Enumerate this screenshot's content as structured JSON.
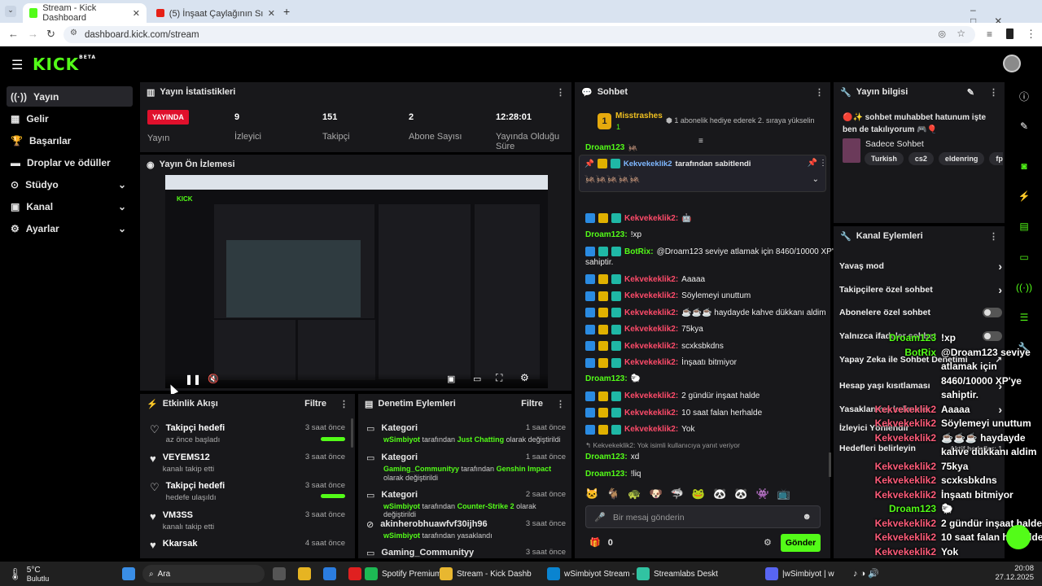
{
  "browser": {
    "tabs": [
      {
        "title": "Stream - Kick Dashboard",
        "active": true
      },
      {
        "title": "(5) İnşaat Çaylağının Sınavı! 😱",
        "active": false
      }
    ],
    "url": "dashboard.kick.com/stream"
  },
  "sidebar": {
    "items": [
      {
        "label": "Yayın",
        "active": true
      },
      {
        "label": "Gelir"
      },
      {
        "label": "Başarılar"
      },
      {
        "label": "Droplar ve ödüller"
      },
      {
        "label": "Stüdyo"
      },
      {
        "label": "Kanal"
      },
      {
        "label": "Ayarlar"
      }
    ]
  },
  "stats": {
    "title": "Yayın İstatistikleri",
    "live_badge": "YAYINDA",
    "live_label": "Yayın",
    "viewers": "9",
    "viewers_label": "İzleyici",
    "followers": "151",
    "followers_label": "Takipçi",
    "subs": "2",
    "subs_label": "Abone Sayısı",
    "uptime": "12:28:01",
    "uptime_label": "Yayında Olduğu Süre"
  },
  "preview": {
    "title": "Yayın Ön İzlemesi"
  },
  "activity": {
    "title": "Etkinlik Akışı",
    "filter": "Filtre",
    "items": [
      {
        "title": "Takipçi hedefi",
        "sub": "az önce başladı",
        "time": "3 saat önce",
        "progress": 1
      },
      {
        "title": "VEYEMS12",
        "sub": "kanalı takip etti",
        "time": "3 saat önce"
      },
      {
        "title": "Takipçi hedefi",
        "sub": "hedefe ulaşıldı",
        "time": "3 saat önce",
        "progress": 1
      },
      {
        "title": "VM3SS",
        "sub": "kanalı takip etti",
        "time": "3 saat önce"
      },
      {
        "title": "Kkarsak",
        "sub": "",
        "time": "4 saat önce"
      }
    ]
  },
  "moderation": {
    "title": "Denetim Eylemleri",
    "filter": "Filtre",
    "items": [
      {
        "title": "Kategori",
        "time": "1 saat önce",
        "actor": "wSimbiyot",
        "mid": "tarafından",
        "value": "Just Chatting",
        "end": "olarak değiştirildi"
      },
      {
        "title": "Kategori",
        "time": "1 saat önce",
        "actor": "Gaming_Communityy",
        "mid": "tarafından",
        "value": "Genshin Impact",
        "end": "olarak değiştirildi"
      },
      {
        "title": "Kategori",
        "time": "2 saat önce",
        "actor": "wSimbiyot",
        "mid": "tarafından",
        "value": "Counter-Strike 2",
        "end": "olarak değiştirildi"
      },
      {
        "title": "akinherobhuawfvf30ijh96",
        "time": "3 saat önce",
        "actor": "wSimbiyot",
        "mid": "tarafından yasaklandı",
        "value": "",
        "end": ""
      },
      {
        "title": "Gaming_Communityy",
        "time": "3 saat önce",
        "actor": "",
        "mid": "",
        "value": "",
        "end": ""
      }
    ]
  },
  "chat": {
    "title": "Sohbet",
    "gifter": "Misstrashes",
    "gifter_rank": "1",
    "gift_note": "1 abonelik hediye ederek 2. sıraya yükselin",
    "pinned_user": "Kekvekeklik2",
    "pinned_text": "tarafından sabitlendi",
    "messages": [
      {
        "user": "Droam123",
        "kind": "green",
        "text": "🦗"
      },
      {
        "user": "Kekvekeklik2:",
        "kind": "red",
        "text": "🤖"
      },
      {
        "user": "Droam123:",
        "kind": "green",
        "text": "!xp"
      },
      {
        "user": "BotRix:",
        "kind": "bot",
        "text": "@Droam123 seviye atlamak için 8460/10000 XP'ye"
      },
      {
        "user": "",
        "kind": "cont",
        "text": "sahiptir."
      },
      {
        "user": "Kekvekeklik2:",
        "kind": "red",
        "text": "Aaaaa"
      },
      {
        "user": "Kekvekeklik2:",
        "kind": "red",
        "text": "Söylemeyi unuttum"
      },
      {
        "user": "Kekvekeklik2:",
        "kind": "red",
        "text": "☕☕☕ haydayde kahve dükkanı aldim"
      },
      {
        "user": "Kekvekeklik2:",
        "kind": "red",
        "text": "75kya"
      },
      {
        "user": "Kekvekeklik2:",
        "kind": "red",
        "text": "scxksbkdns"
      },
      {
        "user": "Kekvekeklik2:",
        "kind": "red",
        "text": "İnşaatı bitmiyor"
      },
      {
        "user": "Droam123:",
        "kind": "green",
        "text": "🐑"
      },
      {
        "user": "Kekvekeklik2:",
        "kind": "red",
        "text": "2 gündür inşaat halde"
      },
      {
        "user": "Kekvekeklik2:",
        "kind": "red",
        "text": "10 saat falan herhalde"
      },
      {
        "user": "Kekvekeklik2:",
        "kind": "red",
        "text": "Yok"
      },
      {
        "user": "",
        "kind": "reply",
        "text": "↰ Kekvekeklik2: Yok isimli kullanıcıya yanıt veriyor"
      },
      {
        "user": "Droam123:",
        "kind": "green",
        "text": "xd"
      },
      {
        "user": "Droam123:",
        "kind": "green",
        "text": "!liq"
      }
    ],
    "input_placeholder": "Bir mesaj gönderin",
    "points": "0",
    "send_label": "Gönder"
  },
  "info": {
    "title": "Yayın bilgisi",
    "stream_title": "🔴✨ sohbet muhabbet hatunum işte ben de takılıyorum 🎮🎈",
    "category": "Sadece Sohbet",
    "tags": [
      "Turkish",
      "cs2",
      "eldenring",
      "fps"
    ]
  },
  "channel_actions": {
    "title": "Kanal Eylemleri",
    "items": [
      {
        "label": "Yavaş mod",
        "ctrl": "chev"
      },
      {
        "label": "Takipçilere özel sohbet",
        "ctrl": "chev"
      },
      {
        "label": "Abonelere özel sohbet",
        "ctrl": "toggle"
      },
      {
        "label": "Yalnızca ifadeler sohbet",
        "ctrl": "toggle"
      },
      {
        "label": "Yapay Zeka ile Sohbet Denetimi",
        "ctrl": "ext"
      },
      {
        "label": "Hesap yaşı kısıtlaması",
        "ctrl": "chev"
      },
      {
        "label": "Yasaklanmış kelimeler",
        "ctrl": "chev"
      },
      {
        "label": "İzleyici Yönlendir",
        "ctrl": "none"
      },
      {
        "label": "Hedefleri belirleyin",
        "ctrl": "none"
      }
    ],
    "goals_hint": "Aktif hedefler: 1"
  },
  "overlay": [
    {
      "user": "Droam123",
      "cls": "green",
      "text": "!xp"
    },
    {
      "user": "BotRix",
      "cls": "green",
      "text": "@Droam123 seviye"
    },
    {
      "user": "",
      "cls": "",
      "text": "atlamak için"
    },
    {
      "user": "",
      "cls": "",
      "text": "8460/10000 XP'ye"
    },
    {
      "user": "",
      "cls": "",
      "text": "sahiptir."
    },
    {
      "user": "Kekvekeklik2",
      "cls": "red",
      "text": "Aaaaa"
    },
    {
      "user": "Kekvekeklik2",
      "cls": "red",
      "text": "Söylemeyi unuttum"
    },
    {
      "user": "Kekvekeklik2",
      "cls": "red",
      "text": "☕☕☕ haydayde"
    },
    {
      "user": "",
      "cls": "",
      "text": "kahve dükkanı aldim"
    },
    {
      "user": "Kekvekeklik2",
      "cls": "red",
      "text": "75kya"
    },
    {
      "user": "Kekvekeklik2",
      "cls": "red",
      "text": "scxksbkdns"
    },
    {
      "user": "Kekvekeklik2",
      "cls": "red",
      "text": "İnşaatı bitmiyor"
    },
    {
      "user": "Droam123",
      "cls": "green",
      "text": "🐑"
    },
    {
      "user": "Kekvekeklik2",
      "cls": "red",
      "text": "2 gündür inşaat halde"
    },
    {
      "user": "Kekvekeklik2",
      "cls": "red",
      "text": "10 saat falan herhalde"
    },
    {
      "user": "Kekvekeklik2",
      "cls": "red",
      "text": "Yok"
    },
    {
      "user": "Droam123",
      "cls": "green",
      "text": "!liq"
    }
  ],
  "taskbar": {
    "weather_temp": "5°C",
    "weather_desc": "Bulutlu",
    "search": "Ara",
    "apps": [
      {
        "label": "Spotify Premium",
        "color": "#1db954"
      },
      {
        "label": "Stream - Kick Dashb",
        "color": "#e8b730"
      },
      {
        "label": "wSimbiyot Stream - '",
        "color": "#0a84d0"
      },
      {
        "label": "Streamlabs Deskt",
        "color": "#31c3a2"
      },
      {
        "label": "|wSimbiyot | w",
        "color": "#5865f2"
      }
    ],
    "time": "20:08",
    "date": "27.12.2025"
  },
  "colors": {
    "accent": "#53fc18",
    "live": "#e0102c",
    "panel": "#18181b"
  }
}
